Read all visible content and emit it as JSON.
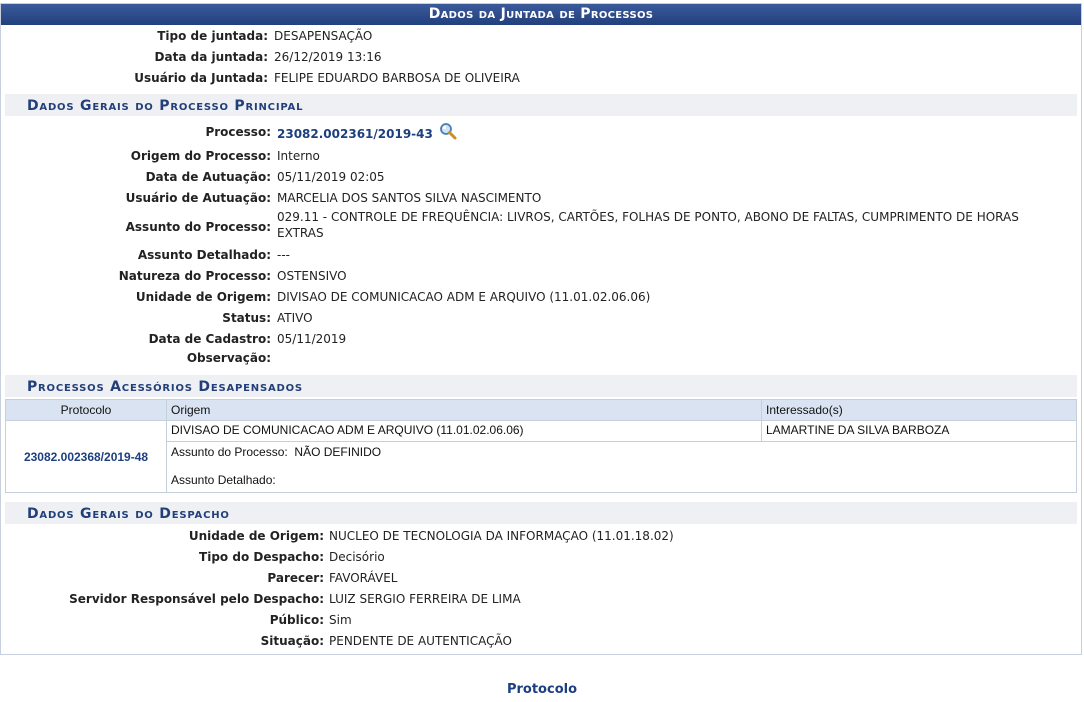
{
  "panel": {
    "title": "Dados da Juntada de Processos"
  },
  "juntada": [
    {
      "label": "Tipo de juntada:",
      "value": "DESAPENSAÇÃO"
    },
    {
      "label": "Data da juntada:",
      "value": "26/12/2019 13:16"
    },
    {
      "label": "Usuário da Juntada:",
      "value": "FELIPE EDUARDO BARBOSA DE OLIVEIRA"
    }
  ],
  "principal": {
    "section_title": "Dados Gerais do Processo Principal",
    "processo_label": "Processo:",
    "processo_value": "23082.002361/2019-43",
    "processo_icon": "magnifier-icon",
    "fields": [
      {
        "label": "Origem do Processo:",
        "value": "Interno"
      },
      {
        "label": "Data de Autuação:",
        "value": "05/11/2019 02:05"
      },
      {
        "label": "Usuário de Autuação:",
        "value": "MARCELIA DOS SANTOS SILVA NASCIMENTO"
      }
    ],
    "assunto_label": "Assunto do Processo:",
    "assunto_line1": "029.11 - CONTROLE DE FREQUÊNCIA: LIVROS, CARTÕES, FOLHAS DE PONTO, ABONO DE FALTAS, CUMPRIMENTO DE HORAS",
    "assunto_line2": "EXTRAS",
    "fields2": [
      {
        "label": "Assunto Detalhado:",
        "value": "---"
      },
      {
        "label": "Natureza do Processo:",
        "value": "OSTENSIVO"
      },
      {
        "label": "Unidade de Origem:",
        "value": "DIVISAO DE COMUNICACAO ADM E ARQUIVO (11.01.02.06.06)"
      },
      {
        "label": "Status:",
        "value": "ATIVO"
      },
      {
        "label": "Data de Cadastro:",
        "value": "05/11/2019"
      },
      {
        "label": "Observação:",
        "value": ""
      }
    ]
  },
  "acessorios": {
    "section_title": "Processos Acessórios Desapensados",
    "columns": [
      "Protocolo",
      "Origem",
      "Interessado(s)"
    ],
    "rows": [
      {
        "protocolo": "23082.002368/2019-48",
        "origem": "DIVISAO DE COMUNICACAO ADM E ARQUIVO (11.01.02.06.06)",
        "interessado": "LAMARTINE DA SILVA BARBOZA",
        "assunto_label": "Assunto do Processo:",
        "assunto_value": "NÃO DEFINIDO",
        "detalhado_label": "Assunto Detalhado:",
        "detalhado_value": ""
      }
    ]
  },
  "despacho": {
    "section_title": "Dados Gerais do Despacho",
    "fields": [
      {
        "label": "Unidade de Origem:",
        "value": "NUCLEO DE TECNOLOGIA DA INFORMAÇAO (11.01.18.02)"
      },
      {
        "label": "Tipo do Despacho:",
        "value": "Decisório"
      },
      {
        "label": "Parecer:",
        "value": "FAVORÁVEL"
      },
      {
        "label": "Servidor Responsável pelo Despacho:",
        "value": "LUIZ SERGIO FERREIRA DE LIMA"
      },
      {
        "label": "Público:",
        "value": "Sim"
      },
      {
        "label": "Situação:",
        "value": "PENDENTE DE AUTENTICAÇÃO"
      }
    ]
  },
  "footer": {
    "link_label": "Protocolo"
  },
  "colors": {
    "header_bg": "#2b4a8b",
    "section_text": "#223f7a",
    "link": "#1c3f7f",
    "table_header_bg": "#d9e3f2"
  }
}
